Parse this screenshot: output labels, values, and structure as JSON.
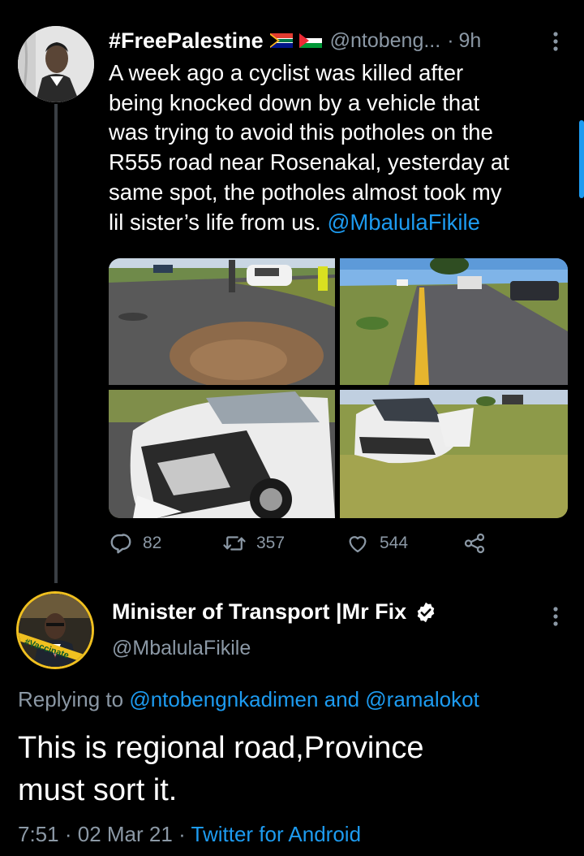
{
  "tweet1": {
    "display_name": "#FreePalestine",
    "handle": "@ntobeng...",
    "separator": "·",
    "time": "9h",
    "text_lines": [
      "A week ago a cyclist was killed after",
      "being knocked down by a vehicle that",
      "was trying to avoid this potholes on the",
      "R555 road near Rosenakal, yesterday at",
      "same spot, the potholes almost took my",
      "lil sister’s life from us. "
    ],
    "mention": "@MbalulaFikile",
    "photo_count": 4,
    "reply_count": "82",
    "retweet_count": "357",
    "like_count": "544"
  },
  "tweet2": {
    "display_name": "Minister of Transport |Mr Fix",
    "handle": "@MbalulaFikile",
    "replying_prefix": "Replying to ",
    "replying_user1": "@ntobengnkadimen",
    "replying_and": " and ",
    "replying_user2": "@ramalokot",
    "text_line1": "This is regional road,Province",
    "text_line2": "must sort it.",
    "time": "7:51",
    "dot": "·",
    "date": "02 Mar 21",
    "source": "Twitter for Android",
    "avatar_badge_text": "#Vaccinate"
  },
  "colors": {
    "background": "#000000",
    "primary_text": "#ffffff",
    "secondary_text": "#8b98a5",
    "link": "#1d9bf0"
  },
  "icons": [
    "za-flag-icon",
    "palestine-flag-icon",
    "more-options-icon",
    "reply-icon",
    "retweet-icon",
    "like-icon",
    "share-icon",
    "verified-icon"
  ]
}
